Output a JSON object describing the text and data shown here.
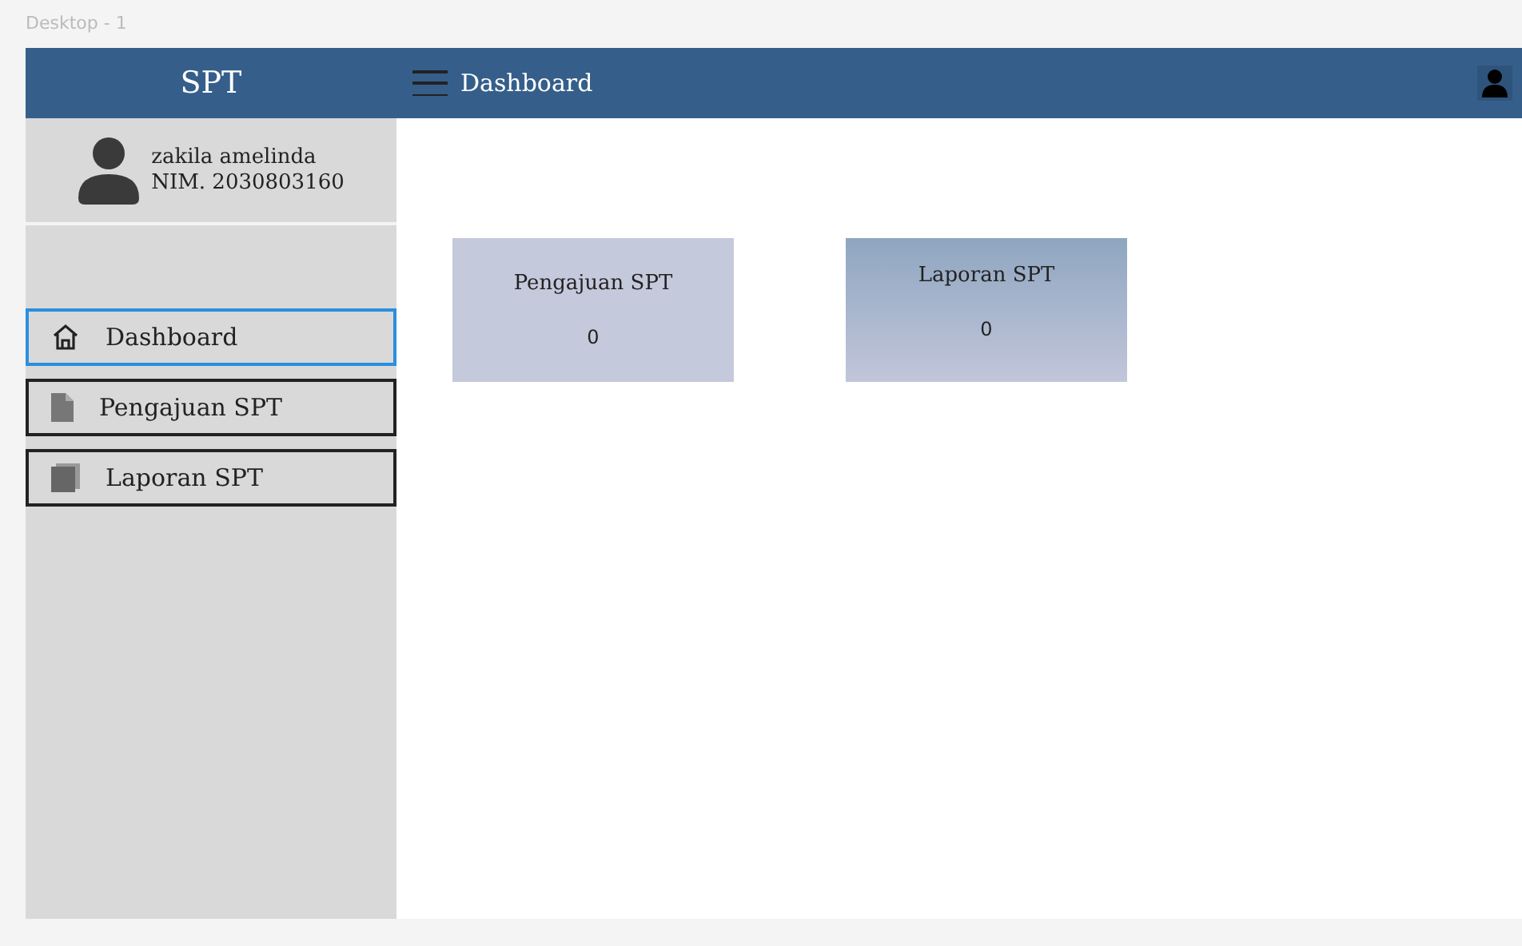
{
  "frame_title": "Desktop - 1",
  "header": {
    "app_name": "SPT",
    "page_title": "Dashboard"
  },
  "profile": {
    "name": "zakila amelinda",
    "nim": "NIM. 2030803160"
  },
  "nav_items": [
    {
      "kind": "home",
      "label": "Dashboard",
      "selected": true
    },
    {
      "kind": "document",
      "label": "Pengajuan SPT",
      "selected": false
    },
    {
      "kind": "book",
      "label": "Laporan SPT",
      "selected": false
    }
  ],
  "cards": [
    {
      "kind": "flat",
      "title": "Pengajuan SPT",
      "value": "0"
    },
    {
      "kind": "gradient",
      "title": "Laporan SPT",
      "value": "0"
    }
  ]
}
